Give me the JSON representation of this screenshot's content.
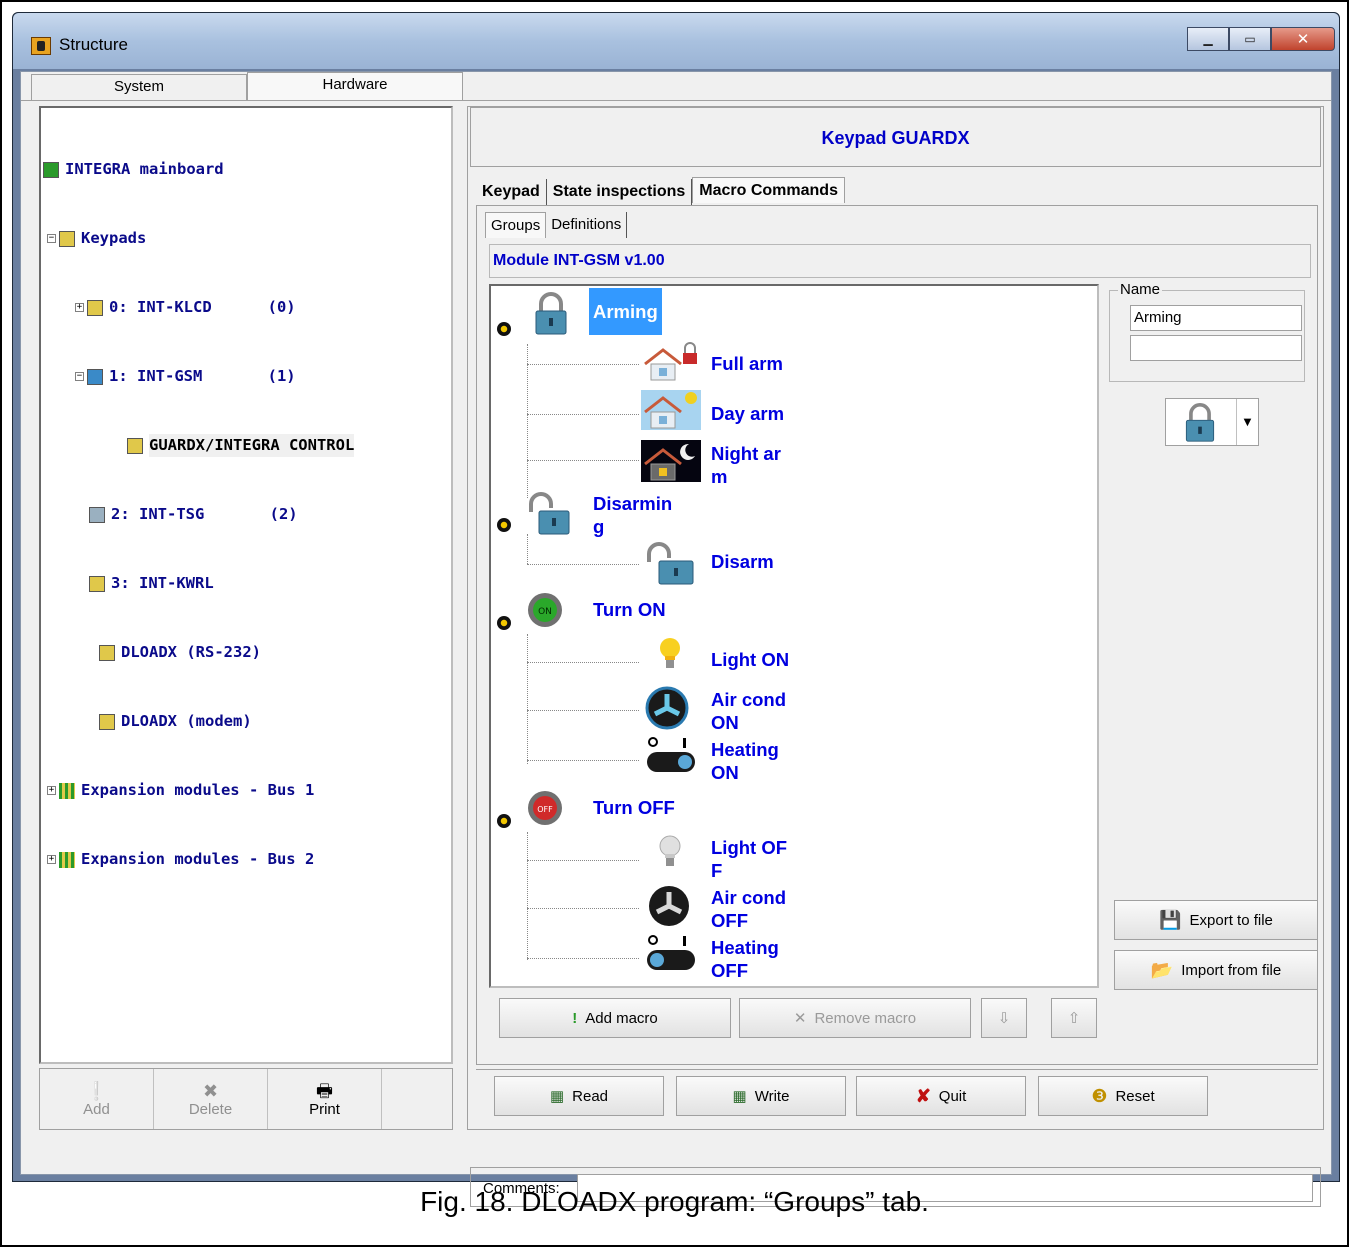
{
  "window": {
    "title": "Structure"
  },
  "top_tabs": [
    {
      "label": "System"
    },
    {
      "label": "Hardware"
    }
  ],
  "tree": [
    {
      "label": "INTEGRA mainboard"
    },
    {
      "label": "Keypads"
    },
    {
      "label": "0: INT-KLCD      (0)"
    },
    {
      "label": "1: INT-GSM       (1)"
    },
    {
      "label": "GUARDX/INTEGRA CONTROL"
    },
    {
      "label": "2: INT-TSG       (2)"
    },
    {
      "label": "3: INT-KWRL"
    },
    {
      "label": "DLOADX (RS-232)"
    },
    {
      "label": "DLOADX (modem)"
    },
    {
      "label": "Expansion modules - Bus 1"
    },
    {
      "label": "Expansion modules - Bus 2"
    }
  ],
  "left_buttons": {
    "add": "Add",
    "delete": "Delete",
    "print": "Print"
  },
  "header_title": "Keypad GUARDX",
  "tabs": [
    {
      "label": "Keypad"
    },
    {
      "label": "State inspections"
    },
    {
      "label": "Macro Commands"
    }
  ],
  "subtabs": [
    {
      "label": "Groups"
    },
    {
      "label": "Definitions"
    }
  ],
  "module_label": "Module INT-GSM v1.00",
  "groups": [
    {
      "label": "Arming",
      "items": [
        "Full arm",
        "Day arm",
        "Night ar\nm"
      ]
    },
    {
      "label": "Disarmin\ng",
      "items": [
        "Disarm"
      ]
    },
    {
      "label": "Turn ON",
      "items": [
        "Light ON",
        "Air cond\nON",
        "Heating\nON"
      ]
    },
    {
      "label": "Turn OFF",
      "items": [
        "Light OF\nF",
        "Air cond\nOFF",
        "Heating\nOFF"
      ]
    }
  ],
  "name_panel": {
    "legend": "Name",
    "value": "Arming",
    "value2": ""
  },
  "side_buttons": {
    "export": "Export to file",
    "import": "Import from file"
  },
  "macro_buttons": {
    "add": "Add macro",
    "remove": "Remove macro"
  },
  "bottom_buttons": {
    "read": "Read",
    "write": "Write",
    "quit": "Quit",
    "reset": "Reset"
  },
  "comments_label": "Comments:",
  "caption": "Fig. 18. DLOADX program: “Groups” tab."
}
